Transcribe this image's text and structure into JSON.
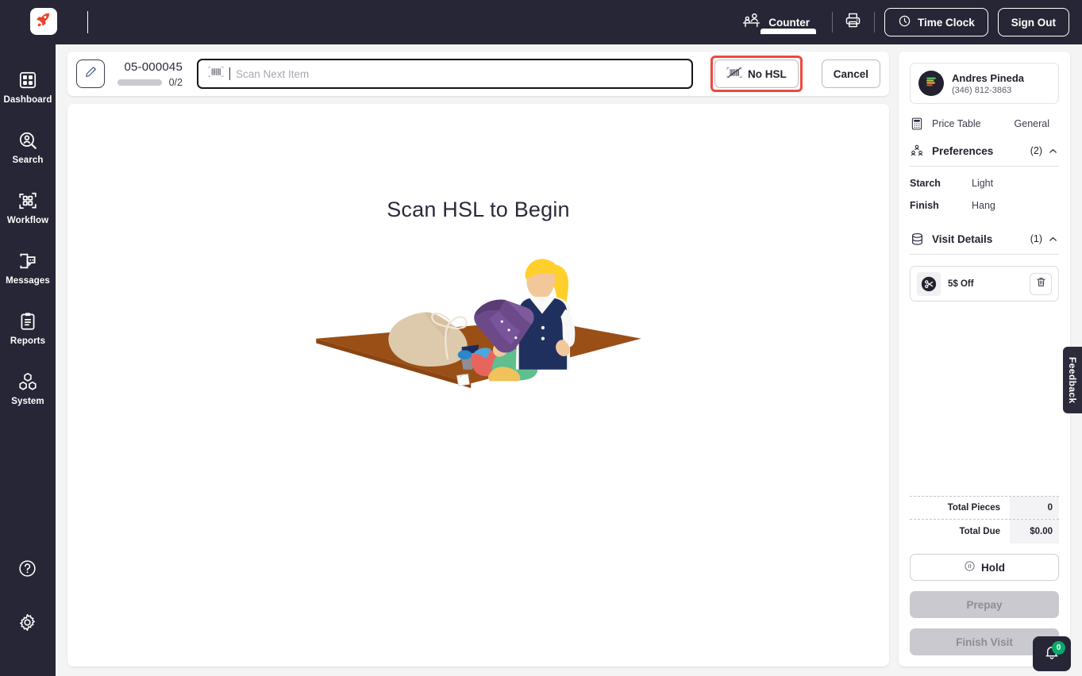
{
  "brand": {
    "logo_icon": "rocket-icon",
    "accent": "#e8462a",
    "rail_bg": "#272636"
  },
  "topbar": {
    "counter_label": "Counter",
    "counter_icon": "counter-desk-icon",
    "printer_icon": "printer-icon",
    "time_clock_label": "Time Clock",
    "time_clock_icon": "clock-icon",
    "sign_out_label": "Sign Out"
  },
  "sidebar": {
    "items": [
      {
        "label": "Dashboard",
        "icon": "dashboard-grid-icon"
      },
      {
        "label": "Search",
        "icon": "search-person-icon"
      },
      {
        "label": "Workflow",
        "icon": "workflow-scan-icon"
      },
      {
        "label": "Messages",
        "icon": "messages-chat-icon"
      },
      {
        "label": "Reports",
        "icon": "reports-clipboard-icon"
      },
      {
        "label": "System",
        "icon": "system-cubes-icon"
      }
    ],
    "bottom_items": [
      {
        "label": "Help",
        "icon": "help-circle-icon"
      },
      {
        "label": "Settings",
        "icon": "gear-icon"
      }
    ]
  },
  "order_bar": {
    "edit_icon": "pencil-icon",
    "order_id": "05-000045",
    "progress_count": "0/2",
    "progress_percent": 0,
    "scan_placeholder": "Scan Next Item",
    "scan_value": "",
    "scan_icon": "barcode-scan-icon",
    "no_hsl_label": "No HSL",
    "no_hsl_icon": "barcode-slash-icon",
    "no_hsl_highlight_color": "#f0483e",
    "cancel_label": "Cancel"
  },
  "canvas": {
    "title": "Scan HSL to Begin",
    "illustration": "laundry-sorting-illustration"
  },
  "customer": {
    "name": "Andres Pineda",
    "phone": "(346) 812-3863",
    "avatar_icon": "customer-avatar-icon"
  },
  "price_table": {
    "icon": "calculator-icon",
    "label": "Price Table",
    "value": "General"
  },
  "preferences": {
    "icon": "people-icon",
    "label": "Preferences",
    "count": "(2)",
    "chevron": "chevron-up-icon",
    "rows": [
      {
        "key": "Starch",
        "value": "Light"
      },
      {
        "key": "Finish",
        "value": "Hang"
      }
    ]
  },
  "visit_details": {
    "icon": "database-icon",
    "label": "Visit Details",
    "count": "(1)",
    "chevron": "chevron-up-icon",
    "items": [
      {
        "label": "5$ Off",
        "icon": "coupon-scissors-icon",
        "delete_icon": "trash-icon"
      }
    ]
  },
  "totals": [
    {
      "label": "Total Pieces",
      "value": "0"
    },
    {
      "label": "Total Due",
      "value": "$0.00"
    }
  ],
  "panel_actions": {
    "hold_label": "Hold",
    "hold_icon": "pause-circle-icon",
    "prepay_label": "Prepay",
    "finish_visit_label": "Finish Visit"
  },
  "feedback": {
    "label": "Feedback"
  },
  "notification": {
    "icon": "bell-icon",
    "count": "0",
    "badge_color": "#0aa86a"
  }
}
